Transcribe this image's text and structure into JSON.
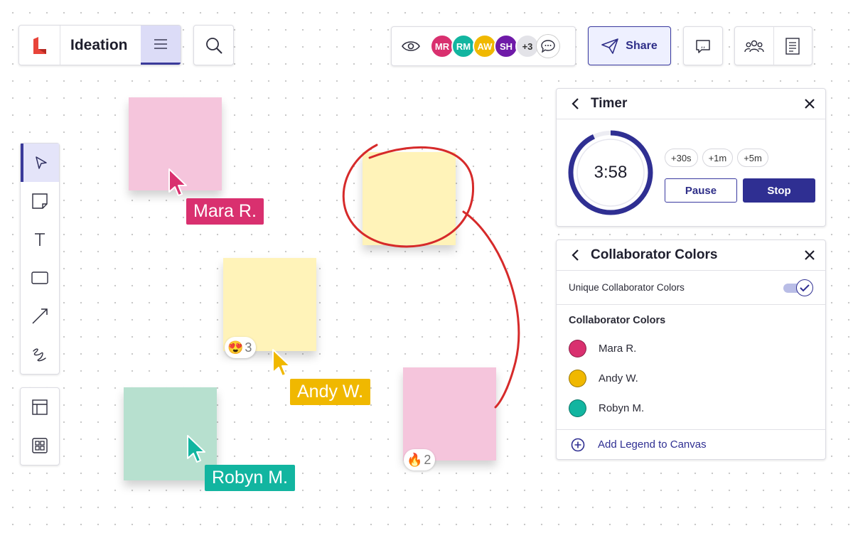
{
  "header": {
    "app_title": "Ideation",
    "logo_icon": "lucid-logo-icon",
    "menu_icon": "hamburger-menu-icon",
    "search_icon": "search-icon"
  },
  "presence": {
    "view_icon": "eye-icon",
    "avatars": [
      {
        "initials": "MR",
        "color": "#d9306f"
      },
      {
        "initials": "RM",
        "color": "#12b5a0"
      },
      {
        "initials": "AW",
        "color": "#f0b800"
      },
      {
        "initials": "SH",
        "color": "#6f1aa8"
      }
    ],
    "overflow_count": "+3",
    "chat_icon": "chat-bubble-icon"
  },
  "share": {
    "label": "Share",
    "icon": "paper-plane-icon"
  },
  "toolbar": {
    "tools": [
      "select-tool",
      "sticky-note-tool",
      "text-tool",
      "shape-tool",
      "line-tool",
      "freehand-tool"
    ],
    "bottom_tools": [
      "template-tool",
      "grid-tool"
    ]
  },
  "canvas": {
    "cursors": [
      {
        "name": "Mara R.",
        "color": "#d9306f"
      },
      {
        "name": "Andy W.",
        "color": "#f0b800"
      },
      {
        "name": "Robyn M.",
        "color": "#12b5a0"
      }
    ],
    "reactions": [
      {
        "emoji": "😍",
        "count": "3"
      },
      {
        "emoji": "🔥",
        "count": "2"
      }
    ]
  },
  "timer": {
    "title": "Timer",
    "time": "3:58",
    "progress": 0.93,
    "increments": [
      "+30s",
      "+1m",
      "+5m"
    ],
    "pause_label": "Pause",
    "stop_label": "Stop"
  },
  "collaborator_colors": {
    "title": "Collaborator Colors",
    "toggle_label": "Unique Collaborator  Colors",
    "toggle_on": true,
    "section_heading": "Collaborator  Colors",
    "people": [
      {
        "name": "Mara R.",
        "color": "#d9306f"
      },
      {
        "name": "Andy W.",
        "color": "#f0b800"
      },
      {
        "name": "Robyn M.",
        "color": "#12b5a0"
      }
    ],
    "add_legend_label": "Add Legend to Canvas"
  },
  "colors": {
    "accent": "#2f2f92",
    "annotation_red": "#d62a2a"
  }
}
